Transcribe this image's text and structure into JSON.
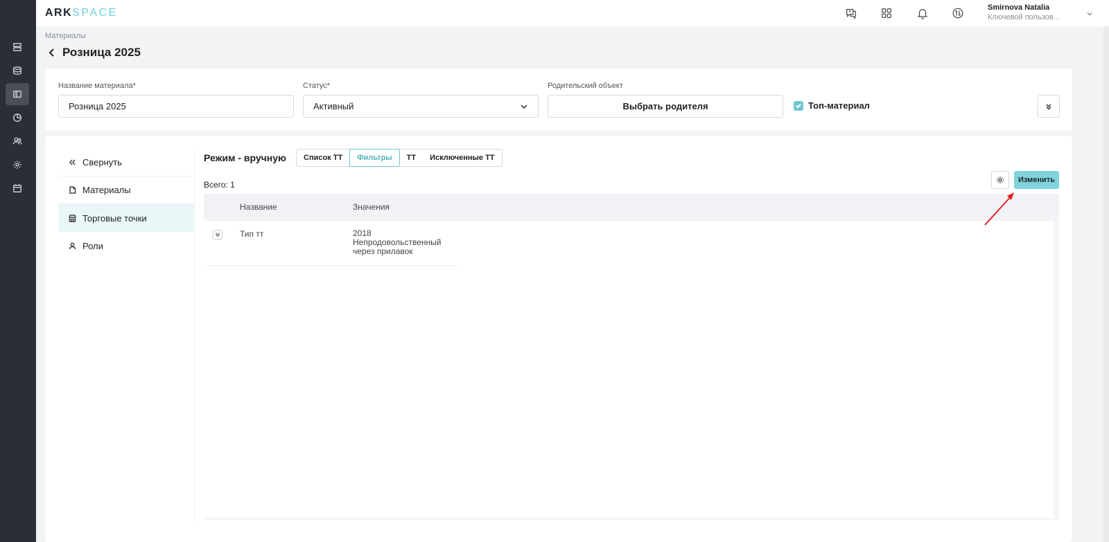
{
  "topbar": {
    "logo_part1": "ARK",
    "logo_part2": "SPACE",
    "icons": [
      "support-chat-icon",
      "apps-grid-icon",
      "bell-icon",
      "sync-icon"
    ],
    "user_name": "Smirnova Natalia",
    "user_role": "Ключевой пользов..."
  },
  "sidebar": {
    "icons": [
      "server-icon",
      "database-icon",
      "materials-panel-icon",
      "chart-pie-icon",
      "users-icon",
      "settings-icon",
      "calendar-icon"
    ],
    "active_index": 2
  },
  "breadcrumb": "Материалы",
  "page_title": "Розница 2025",
  "form": {
    "name_label": "Название материала*",
    "name_value": "Розница 2025",
    "status_label": "Статус*",
    "status_value": "Активный",
    "parent_label": "Родительский объект",
    "parent_button": "Выбрать родителя",
    "top_material_label": "Топ-материал",
    "top_material_checked": true
  },
  "leftnav": {
    "collapse": "Свернуть",
    "items": [
      {
        "label": "Материалы",
        "icon": "document-icon"
      },
      {
        "label": "Торговые точки",
        "icon": "store-icon",
        "active": true
      },
      {
        "label": "Роли",
        "icon": "user-icon"
      }
    ]
  },
  "main": {
    "mode_label": "Режим - вручную",
    "tabs": [
      "Список ТТ",
      "Фильтры",
      "ТТ",
      "Исключенные ТТ"
    ],
    "active_tab": 1,
    "total": "Всего: 1",
    "change_button": "Изменить",
    "table": {
      "headers": [
        "Название",
        "Значения"
      ],
      "rows": [
        {
          "name": "Тип тт",
          "values": [
            "2018",
            "Непродовольственный",
            "через прилавок"
          ]
        }
      ]
    }
  },
  "colors": {
    "accent": "#7fd3da",
    "sidebar_bg": "#2b2e36",
    "annotation_arrow": "#e02020"
  }
}
